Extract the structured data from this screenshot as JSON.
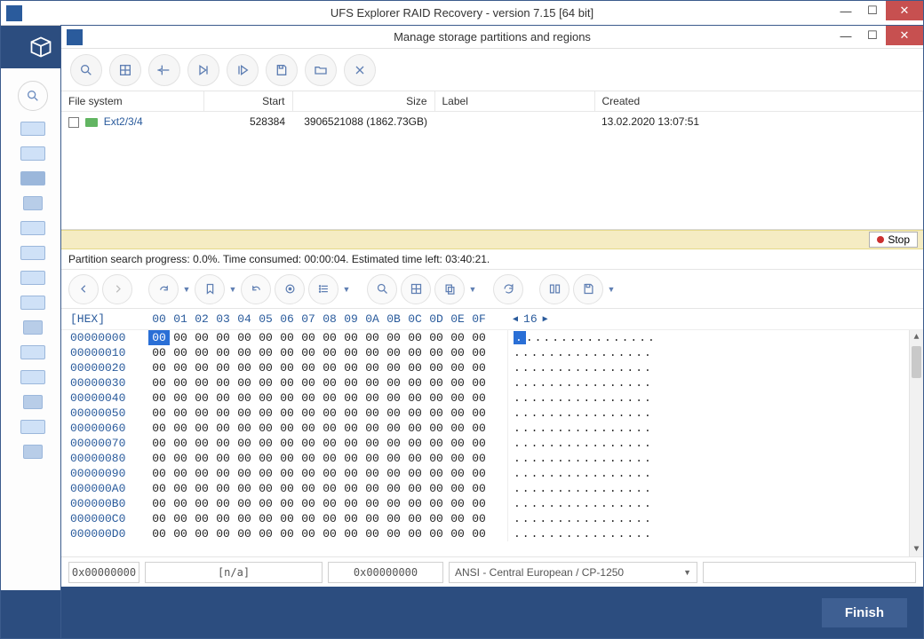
{
  "main_window": {
    "title": "UFS Explorer RAID Recovery - version 7.15 [64 bit]"
  },
  "modal": {
    "title": "Manage storage partitions and regions"
  },
  "toolbar_icons": [
    "search",
    "grid",
    "step-back",
    "step-fwd",
    "play",
    "save",
    "folder",
    "cancel"
  ],
  "partition_table": {
    "headers": {
      "fs": "File system",
      "start": "Start",
      "size": "Size",
      "label": "Label",
      "created": "Created"
    },
    "rows": [
      {
        "fs": "Ext2/3/4",
        "start": "528384",
        "size": "3906521088 (1862.73GB)",
        "label": "",
        "created": "13.02.2020 13:07:51"
      }
    ]
  },
  "stop_label": "Stop",
  "progress_text": "Partition search progress: 0.0%. Time consumed: 00:00:04. Estimated time left: 03:40:21.",
  "toolbar2_icons": [
    "back",
    "forward",
    "redo",
    "bookmark",
    "undo",
    "target",
    "list",
    "search",
    "grid",
    "copy",
    "refresh",
    "columns",
    "disk-save"
  ],
  "hex": {
    "label": "[HEX]",
    "cols": [
      "00",
      "01",
      "02",
      "03",
      "04",
      "05",
      "06",
      "07",
      "08",
      "09",
      "0A",
      "0B",
      "0C",
      "0D",
      "0E",
      "0F"
    ],
    "ascii_width": "16",
    "rows": [
      "00000000",
      "00000010",
      "00000020",
      "00000030",
      "00000040",
      "00000050",
      "00000060",
      "00000070",
      "00000080",
      "00000090",
      "000000A0",
      "000000B0",
      "000000C0",
      "000000D0"
    ],
    "byte": "00",
    "ascii_char": "."
  },
  "status": {
    "offset": "0x00000000",
    "selection": "[n/a]",
    "cursor": "0x00000000",
    "encoding": "ANSI - Central European / CP-1250"
  },
  "finish_label": "Finish",
  "chart_data": null
}
